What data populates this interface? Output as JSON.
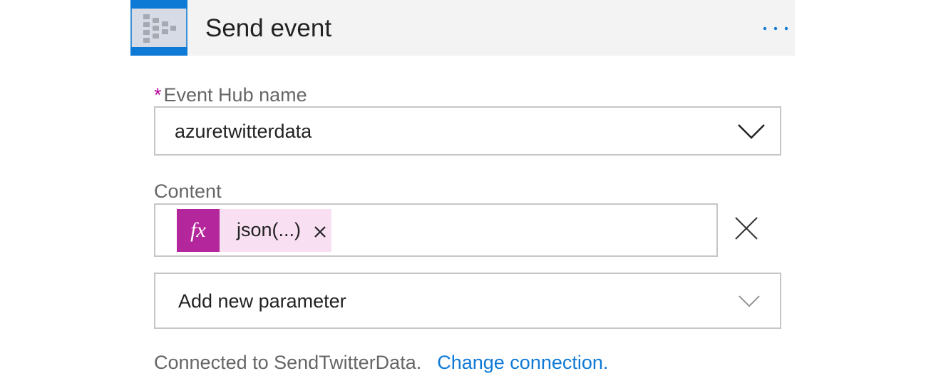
{
  "action": {
    "title": "Send event",
    "icon": "event-hub-icon",
    "more_icon": "more-ellipsis-icon"
  },
  "fields": {
    "event_hub_name": {
      "required_marker": "*",
      "label": "Event Hub name",
      "value": "azuretwitterdata",
      "icon": "chevron-down-icon"
    },
    "content": {
      "label": "Content",
      "token": {
        "icon_text": "fx",
        "label": "json(...)",
        "remove_icon": "close-icon"
      },
      "clear_icon": "close-icon"
    },
    "add_parameter": {
      "placeholder": "Add new parameter",
      "icon": "chevron-down-icon"
    }
  },
  "footer": {
    "connected_text": "Connected to SendTwitterData.",
    "change_link": "Change connection."
  },
  "colors": {
    "accent_blue": "#0f7ad6",
    "required_magenta": "#b4009e",
    "token_bg": "#f8e0f2",
    "token_fx_bg": "#b4279c"
  }
}
